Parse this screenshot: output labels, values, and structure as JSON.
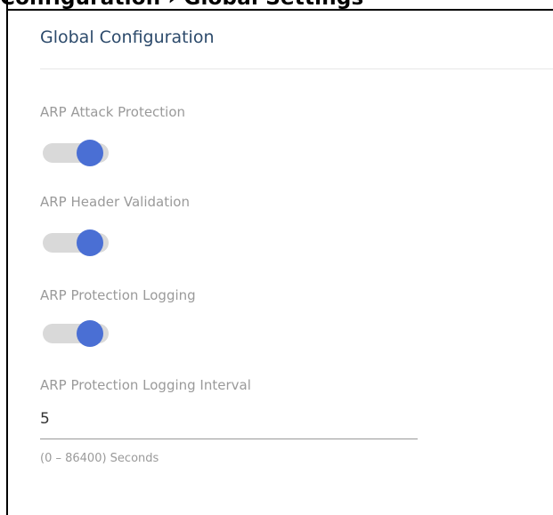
{
  "header": {
    "title_clipped": "Configuration › Global Settings"
  },
  "section": {
    "title": "Global Configuration"
  },
  "fields": [
    {
      "label": "ARP Attack Protection",
      "enabled": true
    },
    {
      "label": "ARP Header Validation",
      "enabled": true
    },
    {
      "label": "ARP Protection Logging",
      "enabled": true
    }
  ],
  "interval": {
    "label": "ARP Protection Logging Interval",
    "value": "5",
    "hint": "(0 – 86400) Seconds"
  },
  "colors": {
    "toggle_on_knob": "#4a6fd4",
    "toggle_track": "#d9d9d9",
    "title": "#2c4a6b",
    "label": "#9a9a9a"
  }
}
